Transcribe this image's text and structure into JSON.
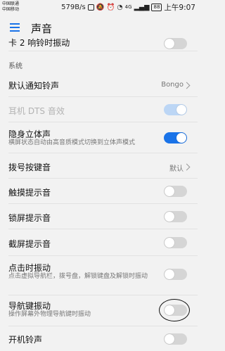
{
  "status_bar": {
    "carrier1": "中国联通",
    "carrier2": "中国移动",
    "net_speed": "579B/s",
    "network": "4G",
    "battery": "88",
    "time": "上午9:07"
  },
  "header": {
    "title": "声音"
  },
  "top_partial": {
    "label": "卡 2 响铃时振动",
    "toggle_on": false
  },
  "section_system": "系统",
  "rows": [
    {
      "title": "默认通知铃声",
      "value": "Bongo",
      "type": "chevron"
    },
    {
      "title": "耳机 DTS 音效",
      "type": "toggle",
      "on": true,
      "disabled": true
    },
    {
      "title": "隐身立体声",
      "subtitle": "横屏状态自动由高音质模式切换到立体声模式",
      "type": "toggle",
      "on": true
    },
    {
      "title": "拨号按键音",
      "value": "默认",
      "type": "chevron"
    },
    {
      "title": "触摸提示音",
      "type": "toggle",
      "on": false
    },
    {
      "title": "锁屏提示音",
      "type": "toggle",
      "on": false
    },
    {
      "title": "截屏提示音",
      "type": "toggle",
      "on": false
    },
    {
      "title": "点击时振动",
      "subtitle": "点击虚拟导航栏，拨号盘，解锁键盘及解锁时振动",
      "type": "toggle",
      "on": false
    },
    {
      "title": "导航键振动",
      "subtitle": "操作屏幕外物理导航键时振动",
      "type": "toggle",
      "on": false
    },
    {
      "title": "开机铃声",
      "type": "toggle",
      "on": false
    }
  ],
  "colors": {
    "accent": "#1a73e8",
    "toggle_off": "#d5d5d5",
    "toggle_disabled_on": "#bcd6f5"
  }
}
